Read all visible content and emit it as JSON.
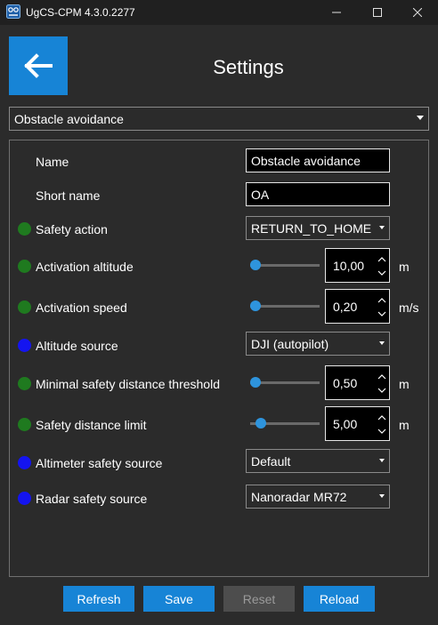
{
  "window": {
    "title": "UgCS-CPM 4.3.0.2277",
    "icon": "ugcs-app-icon",
    "minimize_glyph": "—",
    "maximize_glyph": "☐",
    "close_glyph": "✕"
  },
  "header": {
    "title": "Settings",
    "back_icon": "arrow-left-icon",
    "accent_color": "#1784d6"
  },
  "profile_select": {
    "value": "Obstacle avoidance"
  },
  "settings": {
    "name": {
      "label": "Name",
      "value": "Obstacle avoidance"
    },
    "short_name": {
      "label": "Short name",
      "value": "OA"
    },
    "safety_action": {
      "label": "Safety action",
      "value": "RETURN_TO_HOME",
      "status": "green"
    },
    "activation_altitude": {
      "label": "Activation altitude",
      "value": "10,00",
      "unit": "m",
      "status": "green",
      "slider_fraction": 0.0
    },
    "activation_speed": {
      "label": "Activation speed",
      "value": "0,20",
      "unit": "m/s",
      "status": "green",
      "slider_fraction": 0.0
    },
    "altitude_source": {
      "label": "Altitude source",
      "value": "DJI (autopilot)",
      "status": "blue"
    },
    "minimal_safety_distance": {
      "label": "Minimal safety distance threshold",
      "value": "0,50",
      "unit": "m",
      "status": "green",
      "slider_fraction": 0.0
    },
    "safety_distance_limit": {
      "label": "Safety distance limit",
      "value": "5,00",
      "unit": "m",
      "status": "green",
      "slider_fraction": 0.09
    },
    "altimeter_safety_source": {
      "label": "Altimeter safety source",
      "value": "Default",
      "status": "blue"
    },
    "radar_safety_source": {
      "label": "Radar safety source",
      "value": "Nanoradar MR72",
      "status": "blue"
    }
  },
  "status_colors": {
    "green": "#1f7a1f",
    "blue": "#1414f0"
  },
  "buttons": {
    "refresh": "Refresh",
    "save": "Save",
    "reset": "Reset",
    "reload": "Reload"
  }
}
